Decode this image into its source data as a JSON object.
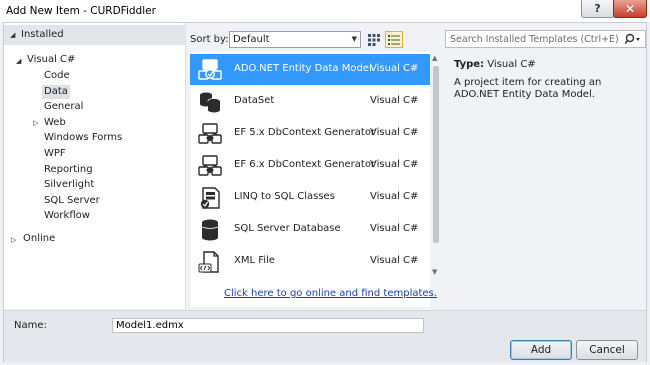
{
  "window": {
    "title": "Add New Item - CURDFiddler",
    "help_label": "?",
    "close_label": "✕"
  },
  "tree": {
    "installed": "Installed",
    "root": "Visual C#",
    "children": [
      {
        "label": "Code",
        "selected": false
      },
      {
        "label": "Data",
        "selected": true
      },
      {
        "label": "General",
        "selected": false
      },
      {
        "label": "Web",
        "selected": false
      },
      {
        "label": "Windows Forms",
        "selected": false
      },
      {
        "label": "WPF",
        "selected": false
      },
      {
        "label": "Reporting",
        "selected": false
      },
      {
        "label": "Silverlight",
        "selected": false
      },
      {
        "label": "SQL Server",
        "selected": false
      },
      {
        "label": "Workflow",
        "selected": false
      }
    ],
    "online": "Online"
  },
  "toolbar": {
    "sort_label": "Sort by:",
    "sort_value": "Default",
    "search_placeholder": "Search Installed Templates (Ctrl+E)"
  },
  "templates": [
    {
      "name": "ADO.NET Entity Data Model",
      "lang": "Visual C#",
      "icon": "entity-model-icon",
      "selected": true
    },
    {
      "name": "DataSet",
      "lang": "Visual C#",
      "icon": "dataset-icon",
      "selected": false
    },
    {
      "name": "EF 5.x DbContext Generator",
      "lang": "Visual C#",
      "icon": "dbcontext-generator-icon",
      "selected": false
    },
    {
      "name": "EF 6.x DbContext Generator",
      "lang": "Visual C#",
      "icon": "dbcontext-generator-icon",
      "selected": false
    },
    {
      "name": "LINQ to SQL Classes",
      "lang": "Visual C#",
      "icon": "linq-classes-icon",
      "selected": false
    },
    {
      "name": "SQL Server Database",
      "lang": "Visual C#",
      "icon": "database-icon",
      "selected": false
    },
    {
      "name": "XML File",
      "lang": "Visual C#",
      "icon": "xml-file-icon",
      "selected": false
    }
  ],
  "online_link": "Click here to go online and find templates.",
  "details": {
    "type_key": "Type:",
    "type_value": "Visual C#",
    "description": "A project item for creating an ADO.NET Entity Data Model."
  },
  "bottom": {
    "name_label": "Name:",
    "name_value": "Model1.edmx",
    "add_label": "Add",
    "cancel_label": "Cancel"
  },
  "colors": {
    "selection": "#3399ff",
    "link": "#1a3fb4",
    "close_button": "#c43f2c"
  }
}
